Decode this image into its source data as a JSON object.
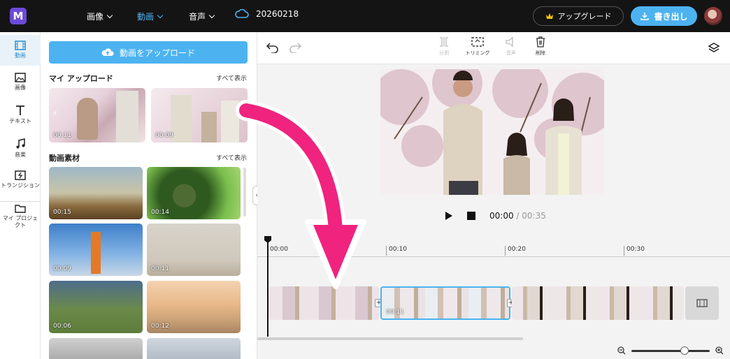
{
  "app": {
    "logo_text": "M",
    "project_name": "20260218"
  },
  "topbar": {
    "menus": [
      {
        "label": "画像"
      },
      {
        "label": "動画"
      },
      {
        "label": "音声"
      }
    ],
    "upgrade_label": "アップグレード",
    "export_label": "書き出し"
  },
  "sidebar": {
    "items": [
      {
        "label": "動画",
        "icon": "video-icon"
      },
      {
        "label": "画像",
        "icon": "image-icon"
      },
      {
        "label": "テキスト",
        "icon": "text-icon"
      },
      {
        "label": "音楽",
        "icon": "music-icon"
      },
      {
        "label": "トランジション",
        "icon": "transition-icon"
      },
      {
        "label": "マイ プロジェクト",
        "icon": "folder-icon"
      }
    ]
  },
  "panel": {
    "upload_label": "動画をアップロード",
    "my_uploads_title": "マイ アップロード",
    "stock_title": "動画素材",
    "see_all_label": "すべて表示",
    "uploads": [
      {
        "duration": "00:11"
      },
      {
        "duration": "00:09"
      }
    ],
    "stock": [
      {
        "duration": "00:15"
      },
      {
        "duration": "00:14"
      },
      {
        "duration": "00:09"
      },
      {
        "duration": "00:11"
      },
      {
        "duration": "00:06"
      },
      {
        "duration": "00:12"
      }
    ]
  },
  "toolbar": {
    "split_label": "分割",
    "trim_label": "トリミング",
    "audio_label": "音声",
    "delete_label": "削除"
  },
  "player": {
    "current_time": "00:00",
    "separator": "/",
    "total_time": "00:35"
  },
  "timeline": {
    "ticks": [
      "00:00",
      "00:10",
      "00:20",
      "00:30"
    ],
    "selected_clip_duration": "00:11"
  },
  "colors": {
    "accent": "#4cb3f0",
    "arrow": "#f0237e",
    "topbar": "#141414"
  }
}
